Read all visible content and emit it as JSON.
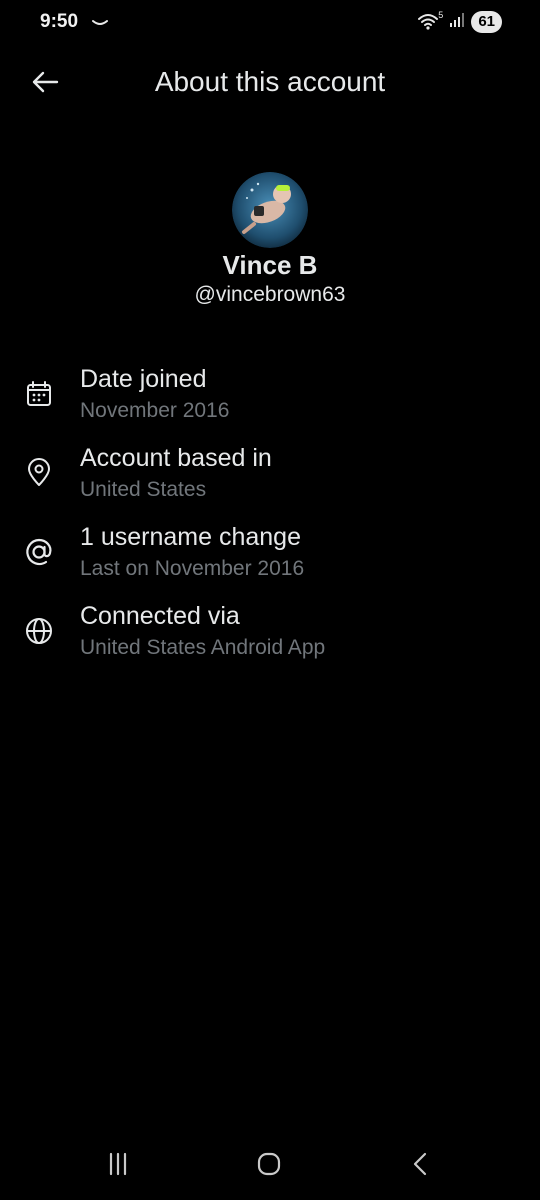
{
  "status_bar": {
    "time": "9:50",
    "battery": "61",
    "network_label": "5"
  },
  "header": {
    "title": "About this account"
  },
  "profile": {
    "name": "Vince B",
    "handle": "@vincebrown63"
  },
  "info_items": [
    {
      "icon": "calendar-icon",
      "title": "Date joined",
      "subtitle": "November 2016"
    },
    {
      "icon": "location-pin-icon",
      "title": "Account based in",
      "subtitle": "United States"
    },
    {
      "icon": "at-sign-icon",
      "title": "1 username change",
      "subtitle": "Last on November 2016"
    },
    {
      "icon": "globe-icon",
      "title": "Connected via",
      "subtitle": "United States Android App"
    }
  ],
  "colors": {
    "background": "#000000",
    "primary_text": "#e7e9ea",
    "secondary_text": "#71767b"
  }
}
